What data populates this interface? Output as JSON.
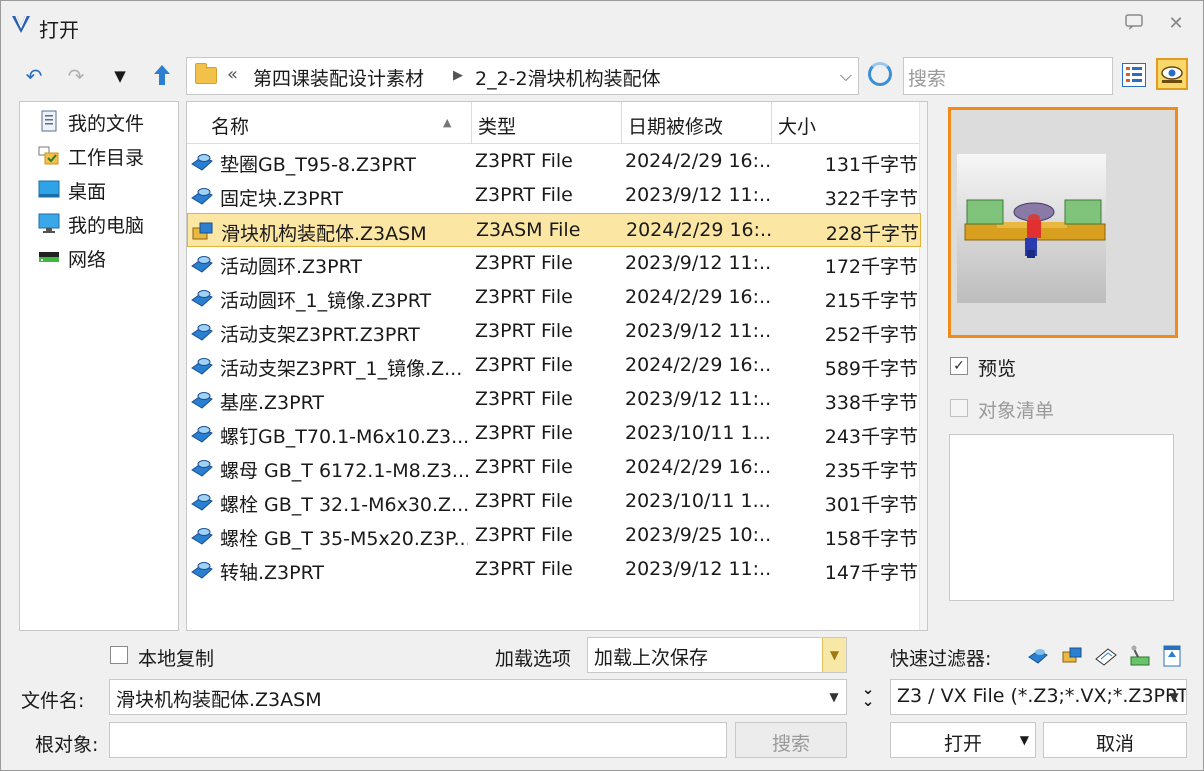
{
  "window": {
    "title": "打开"
  },
  "nav": {
    "back_icon": "back-arrow-icon",
    "forward_icon": "forward-arrow-icon",
    "history_icon": "dropdown-triangle-icon",
    "up_icon": "up-arrow-icon",
    "breadcrumb_prefix": "«",
    "breadcrumb": [
      "第四课装配设计素材",
      "2_2-2滑块机构装配体"
    ],
    "search_placeholder": "搜索"
  },
  "places": [
    {
      "label": "我的文件",
      "icon": "document-icon"
    },
    {
      "label": "工作目录",
      "icon": "work-directory-icon"
    },
    {
      "label": "桌面",
      "icon": "desktop-icon"
    },
    {
      "label": "我的电脑",
      "icon": "computer-icon"
    },
    {
      "label": "网络",
      "icon": "network-icon"
    }
  ],
  "columns": {
    "name": "名称",
    "type": "类型",
    "date": "日期被修改",
    "size": "大小"
  },
  "files": [
    {
      "name": "垫圈GB_T95-8.Z3PRT",
      "type": "Z3PRT File",
      "date": "2024/2/29 16:...",
      "size": "131千字节",
      "kind": "part"
    },
    {
      "name": "固定块.Z3PRT",
      "type": "Z3PRT File",
      "date": "2023/9/12 11:...",
      "size": "322千字节",
      "kind": "part"
    },
    {
      "name": "滑块机构装配体.Z3ASM",
      "type": "Z3ASM File",
      "date": "2024/2/29 16:...",
      "size": "228千字节",
      "kind": "assembly",
      "selected": true
    },
    {
      "name": "活动圆环.Z3PRT",
      "type": "Z3PRT File",
      "date": "2023/9/12 11:...",
      "size": "172千字节",
      "kind": "part"
    },
    {
      "name": "活动圆环_1_镜像.Z3PRT",
      "type": "Z3PRT File",
      "date": "2024/2/29 16:...",
      "size": "215千字节",
      "kind": "part"
    },
    {
      "name": "活动支架Z3PRT.Z3PRT",
      "type": "Z3PRT File",
      "date": "2023/9/12 11:...",
      "size": "252千字节",
      "kind": "part"
    },
    {
      "name": "活动支架Z3PRT_1_镜像.Z...",
      "type": "Z3PRT File",
      "date": "2024/2/29 16:...",
      "size": "589千字节",
      "kind": "part"
    },
    {
      "name": "基座.Z3PRT",
      "type": "Z3PRT File",
      "date": "2023/9/12 11:...",
      "size": "338千字节",
      "kind": "part"
    },
    {
      "name": "螺钉GB_T70.1-M6x10.Z3...",
      "type": "Z3PRT File",
      "date": "2023/10/11 1...",
      "size": "243千字节",
      "kind": "part"
    },
    {
      "name": "螺母 GB_T 6172.1-M8.Z3...",
      "type": "Z3PRT File",
      "date": "2024/2/29 16:...",
      "size": "235千字节",
      "kind": "part"
    },
    {
      "name": "螺栓 GB_T 32.1-M6x30.Z...",
      "type": "Z3PRT File",
      "date": "2023/10/11 1...",
      "size": "301千字节",
      "kind": "part"
    },
    {
      "name": "螺栓 GB_T 35-M5x20.Z3P...",
      "type": "Z3PRT File",
      "date": "2023/9/25 10:...",
      "size": "158千字节",
      "kind": "part"
    },
    {
      "name": "转轴.Z3PRT",
      "type": "Z3PRT File",
      "date": "2023/9/12 11:...",
      "size": "147千字节",
      "kind": "part"
    }
  ],
  "preview": {
    "label": "预览",
    "checked": true,
    "object_list_label": "对象清单",
    "object_list_checked": false
  },
  "bottom": {
    "local_copy_label": "本地复制",
    "load_option_label": "加载选项",
    "load_option_value": "加载上次保存",
    "quick_filter_label": "快速过滤器:",
    "filename_label": "文件名:",
    "filename_value": "滑块机构装配体.Z3ASM",
    "filetype_value": "Z3 / VX File (*.Z3;*.VX;*.Z3PRT",
    "root_object_label": "根对象:",
    "root_object_value": "",
    "search_button": "搜索",
    "open_button": "打开",
    "cancel_button": "取消"
  },
  "colors": {
    "selection_bg": "#fbe6a3",
    "preview_border": "#f28a1a",
    "accent_blue": "#2a7fd0"
  }
}
